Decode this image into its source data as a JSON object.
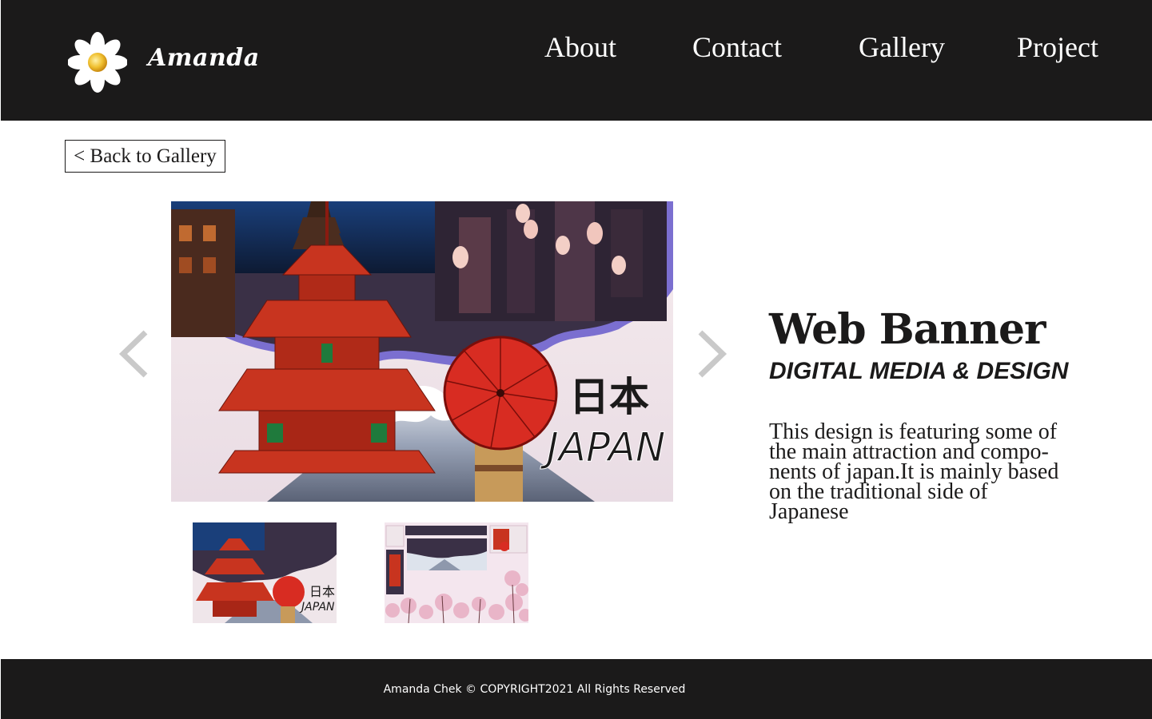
{
  "header": {
    "brand": "Amanda",
    "nav": [
      {
        "label": "About"
      },
      {
        "label": "Contact"
      },
      {
        "label": "Gallery"
      },
      {
        "label": "Project"
      }
    ]
  },
  "back_button": {
    "label": "< Back to Gallery"
  },
  "artwork": {
    "title": "Web Banner",
    "category": "DIGITAL MEDIA & DESIGN",
    "description": "This design is featuring some of the main attraction and compo- nents of japan.It is mainly based on the traditional side of Japanese",
    "banner_text_jp": "日本",
    "banner_text_en": "JAPAN"
  },
  "footer": {
    "copyright": "Amanda Chek © COPYRIGHT2021 All Rights Reserved"
  },
  "colors": {
    "dark": "#1b1a1a",
    "accent_red": "#c8231e",
    "arrow_gray": "#c9c9c9"
  },
  "icons": {
    "logo": "daisy-flower-icon",
    "prev": "chevron-left-icon",
    "next": "chevron-right-icon"
  }
}
